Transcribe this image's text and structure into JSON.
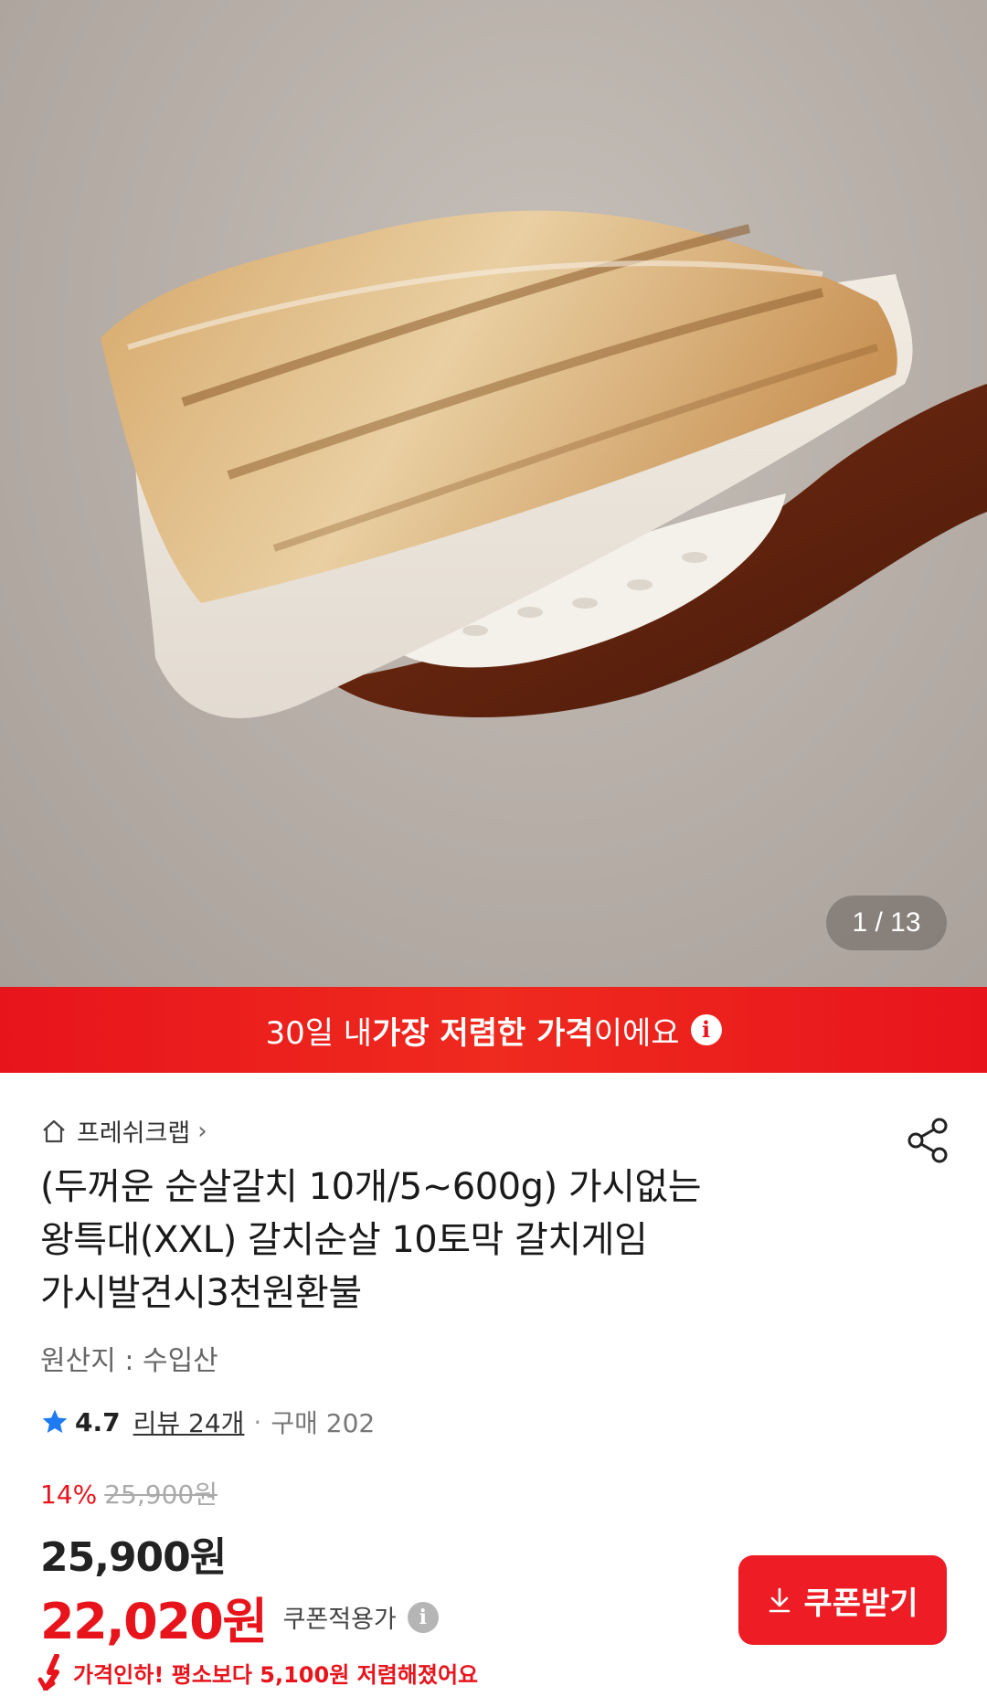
{
  "hero": {
    "pager": "1 / 13",
    "image_icon": "grilled-cutlassfish-on-spoon"
  },
  "banner": {
    "prefix": "30일 내 ",
    "emphasis": "가장 저렴한 가격",
    "suffix": "이에요",
    "icon": "info-icon"
  },
  "product": {
    "store_name": "프레쉬크랩",
    "store_chevron": "›",
    "title_line1": "(두꺼운 순살갈치 10개/5~600g) 가시없는",
    "title_line2": "왕특대(XXL) 갈치순살 10토막 갈치게임",
    "title_line3": "가시발견시3천원환불",
    "origin": "원산지 : 수입산",
    "rating": "4.7",
    "review_link": "리뷰 24개",
    "separator": "·",
    "purchase_count": "구매 202"
  },
  "pricing": {
    "discount_percent": "14%",
    "original_price": "25,900원",
    "price": "25,900원",
    "coupon_price": "22,020원",
    "coupon_label": "쿠폰적용가",
    "coupon_button": "쿠폰받기",
    "price_drop_note": "가격인하! 평소보다 5,100원 저렴해졌어요"
  },
  "colors": {
    "accent_red": "#e8141c",
    "star_blue": "#1e7bf2"
  }
}
